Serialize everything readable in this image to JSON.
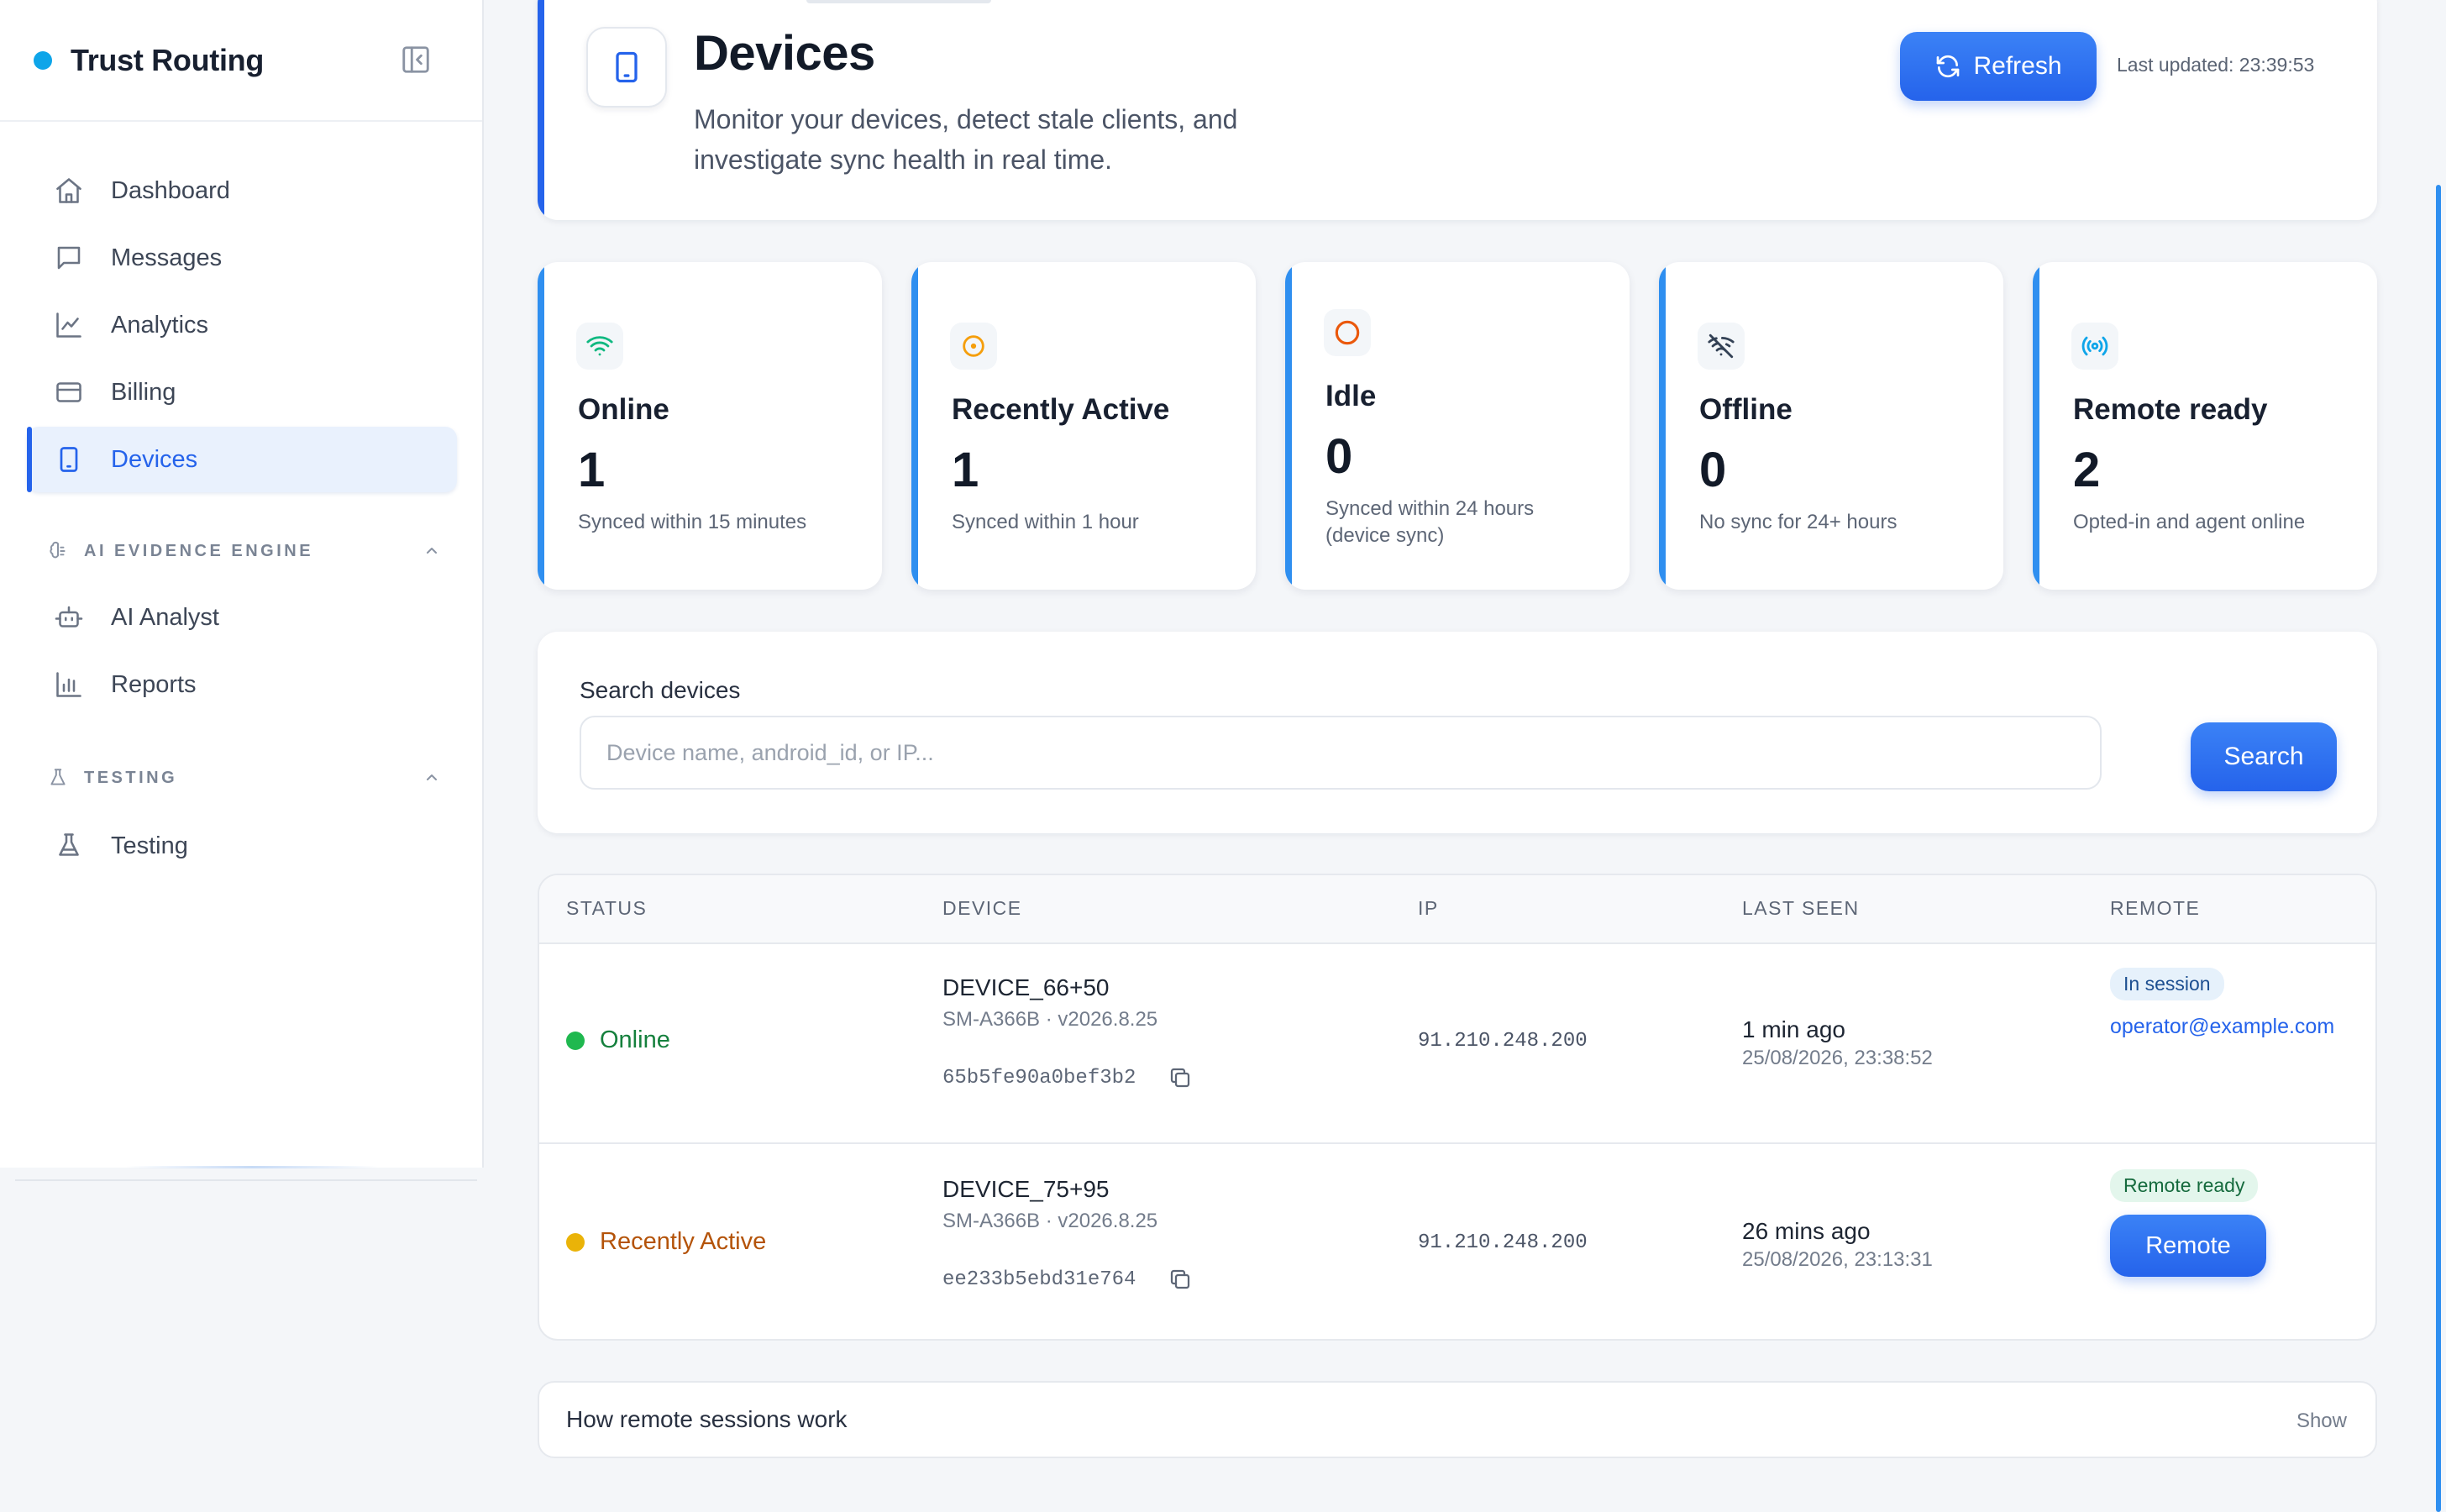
{
  "brand": {
    "title": "Trust Routing",
    "dot_color": "#0ea5e9"
  },
  "sidebar": {
    "items": [
      {
        "label": "Dashboard",
        "icon": "home-icon"
      },
      {
        "label": "Messages",
        "icon": "message-icon"
      },
      {
        "label": "Analytics",
        "icon": "chart-line-icon"
      },
      {
        "label": "Billing",
        "icon": "credit-card-icon"
      },
      {
        "label": "Devices",
        "icon": "tablet-icon",
        "active": true
      }
    ],
    "sections": [
      {
        "title": "AI EVIDENCE ENGINE",
        "icon": "brain-icon",
        "items": [
          {
            "label": "AI Analyst",
            "icon": "bot-icon"
          },
          {
            "label": "Reports",
            "icon": "bar-chart-icon"
          }
        ]
      },
      {
        "title": "TESTING",
        "icon": "flask-icon",
        "items": [
          {
            "label": "Testing",
            "icon": "flask-icon"
          }
        ]
      }
    ]
  },
  "header": {
    "title": "Devices",
    "subtitle": "Monitor your devices, detect stale clients, and investigate sync health in real time.",
    "refresh_label": "Refresh",
    "last_updated": "Last updated: 23:39:53"
  },
  "stats": [
    {
      "label": "Online",
      "value": "1",
      "desc": "Synced within 15 minutes",
      "icon": "wifi-icon",
      "color": "#10b981"
    },
    {
      "label": "Recently Active",
      "value": "1",
      "desc": "Synced within 1 hour",
      "icon": "target-icon",
      "color": "#f59e0b"
    },
    {
      "label": "Idle",
      "value": "0",
      "desc": "Synced within 24 hours (device sync)",
      "icon": "circle-icon",
      "color": "#ea580c"
    },
    {
      "label": "Offline",
      "value": "0",
      "desc": "No sync for 24+ hours",
      "icon": "wifi-off-icon",
      "color": "#334155"
    },
    {
      "label": "Remote ready",
      "value": "2",
      "desc": "Opted-in and agent online",
      "icon": "radio-icon",
      "color": "#0ea5e9"
    }
  ],
  "search": {
    "label": "Search devices",
    "placeholder": "Device name, android_id, or IP...",
    "button_label": "Search"
  },
  "table": {
    "headers": [
      "STATUS",
      "DEVICE",
      "IP",
      "LAST SEEN",
      "REMOTE"
    ],
    "rows": [
      {
        "status": "Online",
        "status_color": "#1fb84f",
        "status_text_color": "#15803d",
        "device_name": "DEVICE_66+50",
        "device_model": "SM-A366B · v2026.8.25",
        "device_id": "65b5fe90a0bef3b2",
        "ip": "91.210.248.200",
        "last_seen_rel": "1 min ago",
        "last_seen_abs": "25/08/2026, 23:38:52",
        "remote_badge": "In session",
        "remote_operator": "operator@example.com"
      },
      {
        "status": "Recently Active",
        "status_color": "#eab308",
        "status_text_color": "#b45309",
        "device_name": "DEVICE_75+95",
        "device_model": "SM-A366B · v2026.8.25",
        "device_id": "ee233b5ebd31e764",
        "ip": "91.210.248.200",
        "last_seen_rel": "26 mins ago",
        "last_seen_abs": "25/08/2026, 23:13:31",
        "remote_badge": "Remote ready",
        "remote_button": "Remote"
      }
    ]
  },
  "help": {
    "title": "How remote sessions work",
    "toggle_label": "Show"
  },
  "colors": {
    "accent": "#2563eb",
    "card_accent": "#2f8ff0"
  }
}
